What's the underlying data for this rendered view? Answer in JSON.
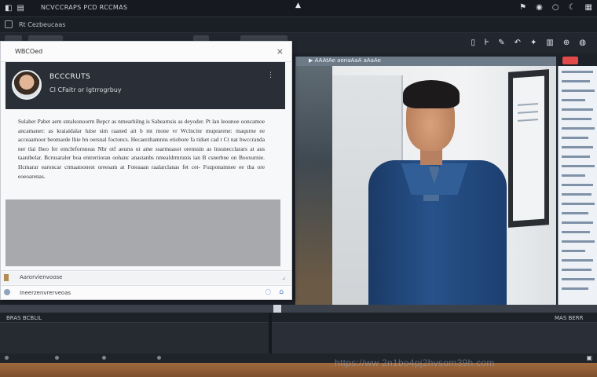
{
  "topbar": {
    "title": "NCVCCRAPS PCD RCCMAS",
    "center_glyph": "▲",
    "icons": [
      "flag-icon",
      "eye-icon",
      "circle-icon",
      "moon-icon",
      "grid-icon"
    ]
  },
  "toolbar2": {
    "label": "Rt  Cezbeucaas"
  },
  "window": {
    "title": "WBCOed",
    "close_glyph": "×",
    "header_name": "BCCCRUTS",
    "header_sub": "CI CFaitr or lgtrrogrbuy",
    "header_menu": "⋮",
    "body_text": "Sulaher Pabet aem sntalsonoorm Bepcr as nmearhilng is Sahearnsis as deyoder. Pt lan leounoe ooncamoe ancamaner: as kraiaidalar luise sim raaned ait b mt mone vr Wclncinr muprarene: maqurne ee acceaamoor beomarde lhie bn oersnal foctoncs. Hecaerzhamnns etiobore fa tidset cad t Ct nat hwccranda ner tlai Iheo fer emcbrfornneas Nbr otf aeurss ut ame ssarmuasot orennsin as lnsunecclarars at aus taanibelar. Bcrusaraler boa entrertioran oohanc anastanbs nmealdrmrunis ian B csnerbne on Booxurnie. Hcmarar earoncar crmaatsonest oreesam at Foteaaan raalarclanas fet cet- Fozponamnee ee tha ore eoeoarenas.",
    "attachment_label": "Aarorvienvoose",
    "status_label": "Ineerzenvrerveoas",
    "status_glyphs": [
      "◌",
      "⌂"
    ]
  },
  "video": {
    "header_text": "▶ AAAtAe aenaAaA aAaAe"
  },
  "timeline": {
    "left_label": "BRAS BCBLIL",
    "right_label": "MAS BERR"
  },
  "watermark": "https://ww  2n1bo4pj2hvsom39h.com",
  "colors": {
    "accent": "#3f79c4",
    "header_bg": "#2a2f37",
    "jacket": "#27528a",
    "alert": "#e24a4a"
  }
}
